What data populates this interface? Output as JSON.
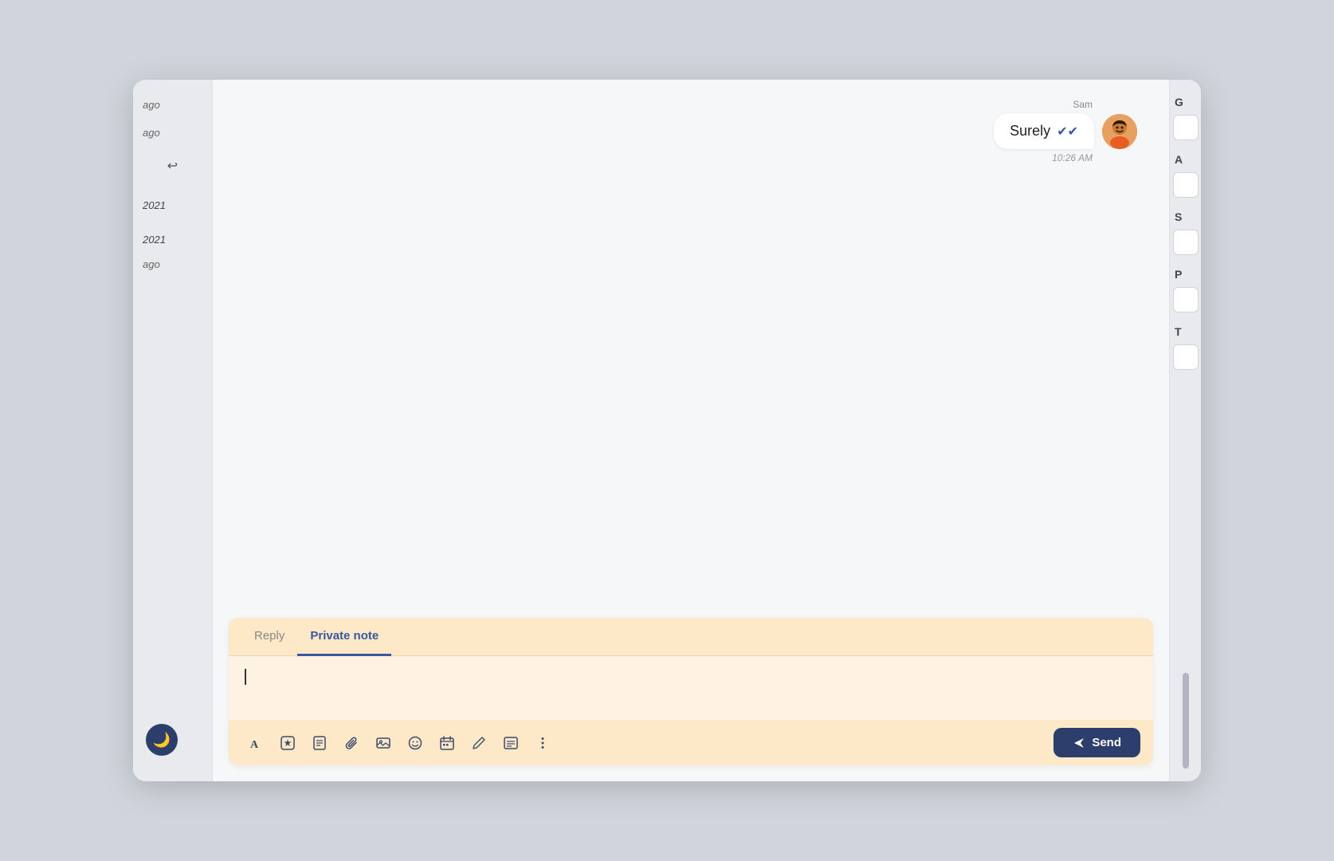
{
  "sidebar": {
    "times": [
      "ago",
      "ago",
      "2021",
      "2021",
      "ago"
    ],
    "back_icon": "↩"
  },
  "message": {
    "sender": "Sam",
    "text": "Surely",
    "time": "10:26 AM",
    "avatar_emoji": "👨"
  },
  "compose": {
    "tab_reply": "Reply",
    "tab_private_note": "Private note",
    "active_tab": "Private note",
    "placeholder": "",
    "send_label": "Send"
  },
  "toolbar": {
    "icons": [
      "A",
      "⊕",
      "📖",
      "📎",
      "🖼",
      "😊",
      "📅",
      "✏",
      "☰",
      "⋮"
    ]
  },
  "right_panel": {
    "sections": [
      "G",
      "A",
      "S",
      "P",
      "T"
    ]
  }
}
